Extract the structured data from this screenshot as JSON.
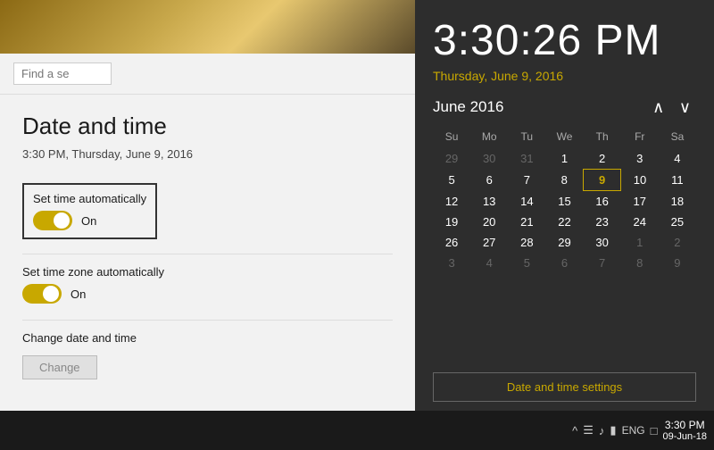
{
  "settings": {
    "title": "Date and time",
    "current_datetime": "3:30 PM, Thursday, June 9, 2016",
    "search_placeholder": "Find a se",
    "set_time_auto": {
      "label": "Set time automatically",
      "state": "On"
    },
    "set_timezone_auto": {
      "label": "Set time zone automatically",
      "state": "On"
    },
    "change_section": {
      "label": "Change date and time",
      "button": "Change"
    }
  },
  "clock": {
    "time": "3:30:26 PM",
    "date": "Thursday, June 9, 2016",
    "calendar": {
      "month_year": "June 2016",
      "weekdays": [
        "Su",
        "Mo",
        "Tu",
        "We",
        "Th",
        "Fr",
        "Sa"
      ],
      "rows": [
        [
          "29",
          "30",
          "31",
          "1",
          "2",
          "3",
          "4"
        ],
        [
          "5",
          "6",
          "7",
          "8",
          "9",
          "10",
          "11"
        ],
        [
          "12",
          "13",
          "14",
          "15",
          "16",
          "17",
          "18"
        ],
        [
          "19",
          "20",
          "21",
          "22",
          "23",
          "24",
          "25"
        ],
        [
          "26",
          "27",
          "28",
          "29",
          "30",
          "1",
          "2"
        ],
        [
          "3",
          "4",
          "5",
          "6",
          "7",
          "8",
          "9"
        ]
      ],
      "other_month_indices": {
        "row0": [
          0,
          1,
          2
        ],
        "row4": [
          5,
          6
        ],
        "row5": [
          0,
          1,
          2,
          3,
          4,
          5,
          6
        ]
      },
      "today": {
        "row": 1,
        "col": 4
      }
    },
    "settings_link": "Date and time settings"
  },
  "taskbar": {
    "time": "3:30 PM",
    "date": "09-Jun-18",
    "lang": "ENG",
    "icons": [
      "network-icon",
      "volume-icon",
      "notification-icon",
      "chat-icon"
    ]
  }
}
